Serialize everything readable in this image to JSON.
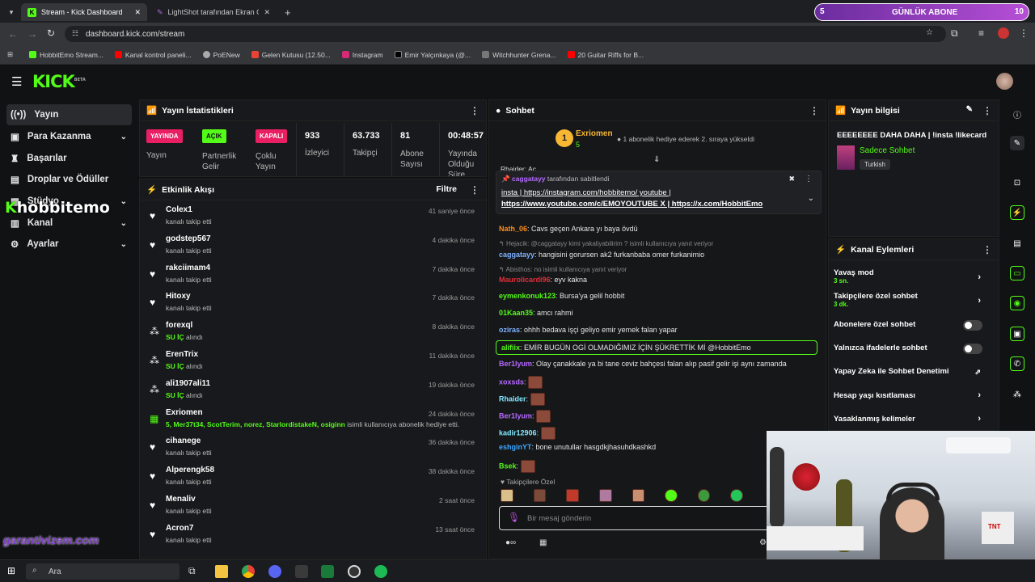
{
  "browser": {
    "tabs": [
      {
        "label": "Stream - Kick Dashboard",
        "active": true
      },
      {
        "label": "LightShot tarafından Ekran Gör...",
        "active": false
      }
    ],
    "url": "dashboard.kick.com/stream",
    "bookmarks": [
      "HobbitEmo Stream...",
      "Kanal kontrol paneli...",
      "PoENew",
      "Gelen Kutusu (12.50...",
      "Instagram",
      "Emir Yalçınkaya (@...",
      "Witchhunter Grena...",
      "20 Guitar Riffs for B..."
    ],
    "overlay": {
      "count": "5",
      "label": "GÜNLÜK ABONE",
      "value": "10"
    }
  },
  "header": {
    "logo": "KICK",
    "beta": "BETA"
  },
  "sidebar": {
    "items": [
      {
        "label": "Yayın",
        "icon": "broadcast-icon",
        "active": true
      },
      {
        "label": "Para Kazanma",
        "icon": "money-icon",
        "chevron": true
      },
      {
        "label": "Başarılar",
        "icon": "trophy-icon"
      },
      {
        "label": "Droplar ve Ödüller",
        "icon": "gift-icon"
      },
      {
        "label": "Stüdyo",
        "icon": "studio-icon",
        "chevron": true
      },
      {
        "label": "Kanal",
        "icon": "channel-icon",
        "chevron": true
      },
      {
        "label": "Ayarlar",
        "icon": "gear-icon",
        "chevron": true
      }
    ],
    "overlay_name": "hobbitemo"
  },
  "stats": {
    "title": "Yayın İstatistikleri",
    "cards": [
      {
        "badge": "YAYINDA",
        "color": "#e91e63",
        "label": "Yayın"
      },
      {
        "badge": "AÇIK",
        "color": "#53fc18",
        "label": "Partnerlik Gelir"
      },
      {
        "badge": "KAPALI",
        "color": "#e91e63",
        "label": "Çoklu Yayın"
      },
      {
        "value": "933",
        "label": "İzleyici"
      },
      {
        "value": "63.733",
        "label": "Takipçi"
      },
      {
        "value": "81",
        "label": "Abone Sayısı"
      },
      {
        "value": "00:48:57",
        "label": "Yayında Olduğu Süre"
      }
    ]
  },
  "activity": {
    "title": "Etkinlik Akışı",
    "filter": "Filtre",
    "items": [
      {
        "name": "Colex1",
        "sub": "kanalı takip etti",
        "time": "41 saniye önce",
        "type": "follow"
      },
      {
        "name": "godstep567",
        "sub": "kanalı takip etti",
        "time": "4 dakika önce",
        "type": "follow"
      },
      {
        "name": "rakciimam4",
        "sub": "kanalı takip etti",
        "time": "7 dakika önce",
        "type": "follow"
      },
      {
        "name": "Hitoxy",
        "sub": "kanalı takip etti",
        "time": "7 dakika önce",
        "type": "follow"
      },
      {
        "name": "forexql",
        "hl": "SU İÇ",
        "sub": "alındı",
        "time": "8 dakika önce",
        "type": "reward"
      },
      {
        "name": "ErenTrix",
        "hl": "SU İÇ",
        "sub": "alındı",
        "time": "11 dakika önce",
        "type": "reward"
      },
      {
        "name": "ali1907ali11",
        "hl": "SU İÇ",
        "sub": "alındı",
        "time": "19 dakika önce",
        "type": "reward"
      },
      {
        "name": "Exriomen",
        "hl": "5, Mer37t34, ScotTerim, norez, StarlordistakeN, osiginn",
        "sub": "isimli kullanıcıya abonelik hediye etti.",
        "time": "24 dakika önce",
        "type": "gift"
      },
      {
        "name": "cihanege",
        "sub": "kanalı takip etti",
        "time": "36 dakika önce",
        "type": "follow"
      },
      {
        "name": "Alperengk58",
        "sub": "kanalı takip etti",
        "time": "38 dakika önce",
        "type": "follow"
      },
      {
        "name": "Menaliv",
        "sub": "kanalı takip etti",
        "time": "2 saat önce",
        "type": "follow"
      },
      {
        "name": "Acron7",
        "sub": "kanalı takip etti",
        "time": "13 saat önce",
        "type": "follow"
      }
    ]
  },
  "chat": {
    "title": "Sohbet",
    "top_gifter": {
      "name": "Exriomen",
      "count": "5",
      "rank": "1",
      "msg": "1 abonelik hediye ederek 2. sıraya yükseldi"
    },
    "pinned": {
      "by": "caggatayy",
      "by_text": "tarafından sabitlendi",
      "line1": "insta | https://instagram.com/hobbitemo/ youtube |",
      "line2": "https://www.youtube.com/c/EMOYOUTUBE X | https://x.com/HobbitEmo"
    },
    "behind": "Rhaider: Ac",
    "messages": [
      {
        "user": "Nath_06",
        "color": "#ff8c1a",
        "text": ": Cavs geçen Ankara yı baya övdü"
      },
      {
        "reply": "Hejacik: @caggatayy kimi yakaliyabilirim ? isimli kullanıcıya yanıt veriyor"
      },
      {
        "user": "caggatayy",
        "color": "#7fb2ff",
        "text": ": hangisini gorursen ak2 furkanbaba omer furkanimio"
      },
      {
        "reply": "Abisthos: no isimli kullanıcıya yanıt veriyor"
      },
      {
        "user": "Maurolicardi96",
        "color": "#e0303a",
        "text": ": eyv kakna"
      },
      {
        "user": "eymenkonuk123",
        "color": "#53fc18",
        "text": ": Bursa'ya gelil hobbit"
      },
      {
        "user": "01Kaan35",
        "color": "#53fc18",
        "text": ": amcı rahmi"
      },
      {
        "user": "oziras",
        "color": "#7fb2ff",
        "text": ": ohhh bedava işçi geliyo emir yemek falan yapar"
      },
      {
        "user": "alifiix",
        "color": "#53fc18",
        "text": ": EMİR BUGÜN OGİ OLMADIĞIMIZ İÇİN ŞÜKRETTİK Mİ @HobbitEmo",
        "highlight": true
      },
      {
        "user": "Ber1lyum",
        "color": "#b469ff",
        "text": ": Olay çanakkale ya bi tane ceviz bahçesi falan alıp pasif gelir işi aynı zamanda"
      },
      {
        "user": "xoxsds",
        "color": "#b469ff",
        "emote": true
      },
      {
        "user": "Rhaider",
        "color": "#7fe8ff",
        "emote": true
      },
      {
        "user": "Ber1lyum",
        "color": "#b469ff",
        "emote": true
      },
      {
        "user": "kadir12906",
        "color": "#7fe8ff",
        "emote": true
      },
      {
        "user": "eshginYT",
        "color": "#3ba8ff",
        "text": ": bone unutullar hasgdkjhasuhdkashkd"
      },
      {
        "user": "Bsek",
        "color": "#53fc18",
        "emote": true
      }
    ],
    "followers_only": "Takipçilere Özel",
    "input_placeholder": "Bir mesaj gönderin"
  },
  "stream_info": {
    "title": "Yayın bilgisi",
    "stream_title": "EEEEEEEE DAHA DAHA | !insta !likecard",
    "category": "Sadece Sohbet",
    "language": "Turkish"
  },
  "channel_actions": {
    "title": "Kanal Eylemleri",
    "items": [
      {
        "label": "Yavaş mod",
        "sub": "3 sn.",
        "type": "chevron"
      },
      {
        "label": "Takipçilere özel sohbet",
        "sub": "3 dk.",
        "type": "chevron"
      },
      {
        "label": "Abonelere özel sohbet",
        "type": "toggle"
      },
      {
        "label": "Yalnızca ifadelerle sohbet",
        "type": "toggle"
      },
      {
        "label": "Yapay Zeka ile Sohbet Denetimi",
        "type": "external"
      },
      {
        "label": "Hesap yaşı kısıtlaması",
        "type": "chevron"
      },
      {
        "label": "Yasaklanmış kelimeler",
        "type": "chevron"
      }
    ]
  },
  "watermark": "garantivizem.com",
  "taskbar": {
    "search": "Ara"
  }
}
